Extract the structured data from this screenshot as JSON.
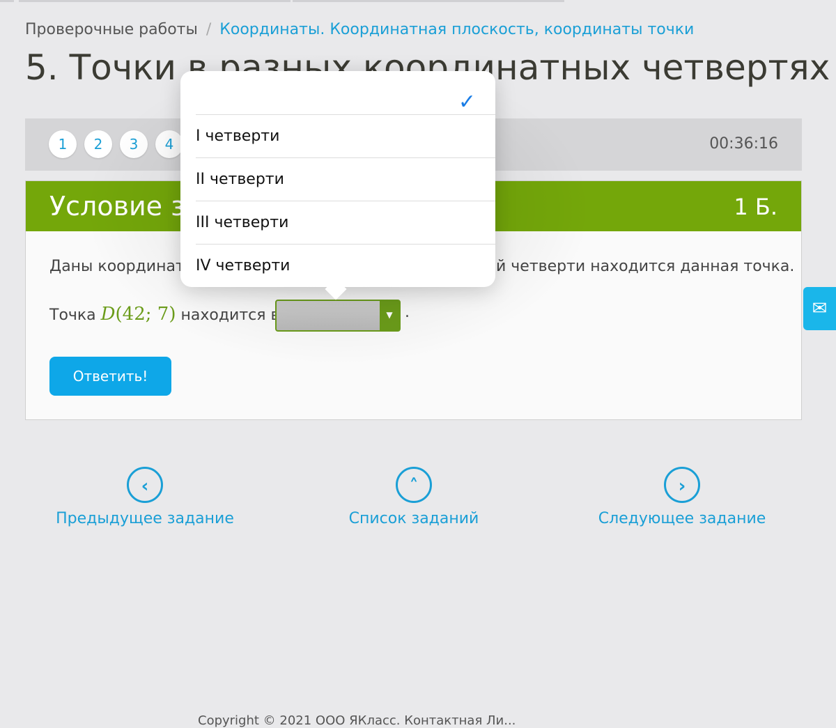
{
  "breadcrumb": {
    "root": "Проверочные работы",
    "separator": "/",
    "current": "Координаты. Координатная плоскость, координаты точки"
  },
  "page_title": "5. Точки в разных координатных четвертях",
  "task_numbers": [
    "1",
    "2",
    "3",
    "4"
  ],
  "timer": "00:36:16",
  "card": {
    "title": "Условие за",
    "points": "1 Б.",
    "question_start": "Даны координат",
    "question_end": "й четверти находится данная точка.",
    "point_prefix": "Точка",
    "point_name": "D",
    "point_coords": "(42; 7)",
    "point_suffix": "находится в",
    "select_value": "",
    "trailing_dot": ".",
    "submit_label": "Ответить!"
  },
  "dropdown": {
    "selected_option": "",
    "check_glyph": "✓",
    "options": [
      "I четверти",
      "II четверти",
      "III четверти",
      "IV четверти"
    ]
  },
  "nav": {
    "prev_label": "Предыдущее задание",
    "list_label": "Список заданий",
    "next_label": "Следующее задание",
    "prev_icon": "chevron-left-icon",
    "list_icon": "chevron-up-icon",
    "next_icon": "chevron-right-icon"
  },
  "feedback_icon": "mail-icon",
  "footer": "Copyright © 2021 ООО ЯКласс. Контактная Ли...",
  "colors": {
    "accent_blue": "#1a9fd6",
    "header_green": "#74a70a",
    "point_green": "#6b9c1a",
    "button_blue": "#0ea7e8",
    "check_blue": "#1a7de6"
  }
}
